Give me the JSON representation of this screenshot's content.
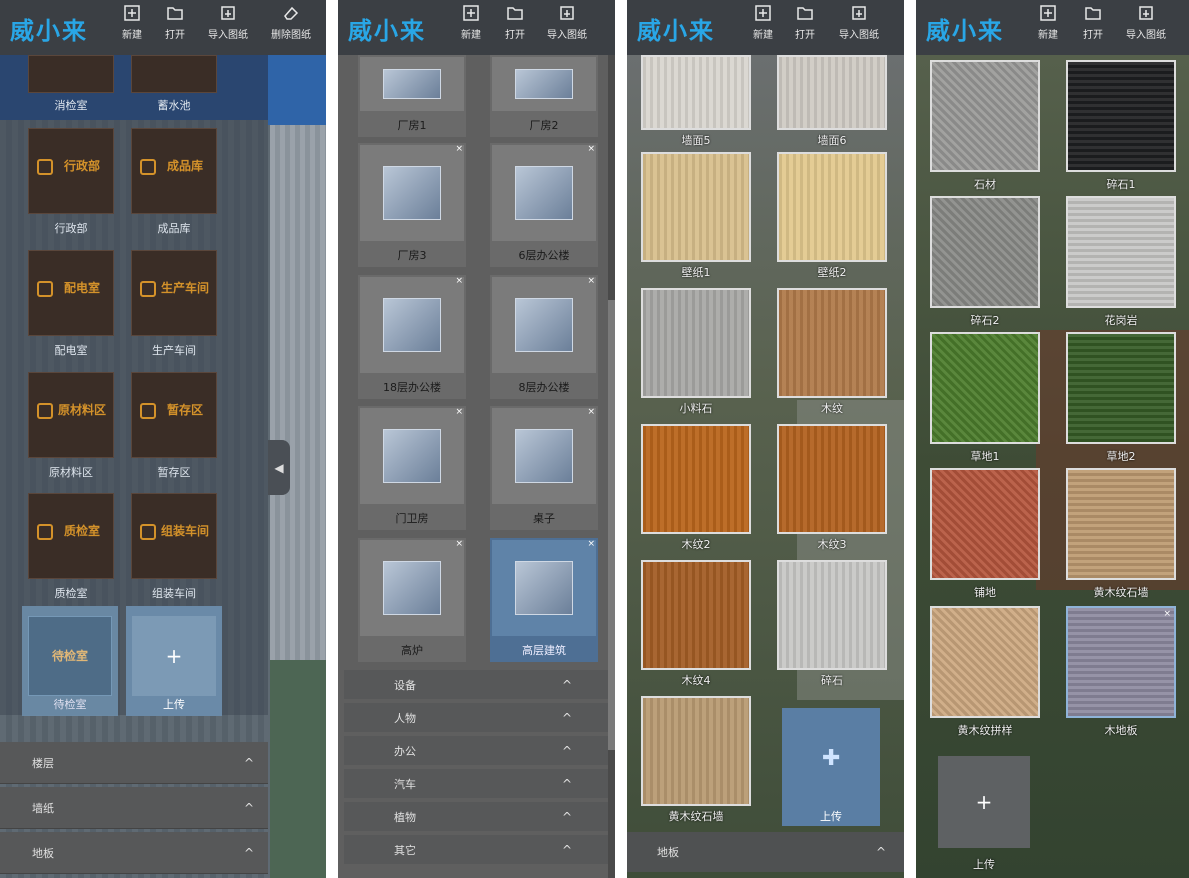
{
  "app": {
    "logo": "威小来"
  },
  "toolbar": {
    "new": "新建",
    "open": "打开",
    "import": "导入图纸",
    "delete": "删除图纸"
  },
  "panel1": {
    "top_labels": [
      "消检室",
      "蓄水池"
    ],
    "signs": [
      {
        "sign_text": "行政部",
        "label": "行政部"
      },
      {
        "sign_text": "成品库",
        "label": "成品库"
      },
      {
        "sign_text": "配电室",
        "label": "配电室"
      },
      {
        "sign_text": "生产车间",
        "label": "生产车间"
      },
      {
        "sign_text": "原材料区",
        "label": "原材料区"
      },
      {
        "sign_text": "暂存区",
        "label": "暂存区"
      },
      {
        "sign_text": "质检室",
        "label": "质检室"
      },
      {
        "sign_text": "组装车间",
        "label": "组装车间"
      }
    ],
    "selected": {
      "sign_text": "待检室",
      "label": "待检室"
    },
    "upload": {
      "symbol": "+",
      "label": "上传"
    },
    "sections": [
      "楼层",
      "墙纸",
      "地板"
    ]
  },
  "panel2": {
    "cards": [
      {
        "label": "厂房1"
      },
      {
        "label": "厂房2"
      },
      {
        "label": "厂房3"
      },
      {
        "label": "6层办公楼"
      },
      {
        "label": "18层办公楼"
      },
      {
        "label": "8层办公楼"
      },
      {
        "label": "门卫房"
      },
      {
        "label": "桌子"
      },
      {
        "label": "高炉"
      },
      {
        "label": "高层建筑"
      }
    ],
    "close": "×",
    "sections": [
      "设备",
      "人物",
      "办公",
      "汽车",
      "植物",
      "其它"
    ],
    "chevron": "^"
  },
  "panel3": {
    "textures": [
      {
        "label": "墙面5",
        "color": "#d9d6cf"
      },
      {
        "label": "墙面6",
        "color": "#cfcbc4"
      },
      {
        "label": "壁纸1",
        "color": "#d8bf8c"
      },
      {
        "label": "壁纸2",
        "color": "#e2c98e"
      },
      {
        "label": "小料石",
        "color": "#a8a8a6"
      },
      {
        "label": "木纹",
        "color": "#b07a4a"
      },
      {
        "label": "木纹2",
        "color": "#b9651c"
      },
      {
        "label": "木纹3",
        "color": "#b1611f"
      },
      {
        "label": "木纹4",
        "color": "#a35d25"
      },
      {
        "label": "碎石",
        "color": "#c8c8c6"
      },
      {
        "label": "黄木纹石墙",
        "color": "#b89a72"
      }
    ],
    "upload_label": "上传",
    "section": "地板"
  },
  "panel4": {
    "textures": [
      {
        "label": "石材",
        "color": "#9a9a98"
      },
      {
        "label": "碎石1",
        "color": "#1e1f21"
      },
      {
        "label": "碎石2",
        "color": "#8a8b88"
      },
      {
        "label": "花岗岩",
        "color": "#c7c7c5"
      },
      {
        "label": "草地1",
        "color": "#4c7d2c"
      },
      {
        "label": "草地2",
        "color": "#355b26"
      },
      {
        "label": "铺地",
        "color": "#b5563d"
      },
      {
        "label": "黄木纹石墙",
        "color": "#bd9a70"
      },
      {
        "label": "黄木纹拼样",
        "color": "#cda880"
      },
      {
        "label": "木地板",
        "color": "#8d8aa0"
      }
    ],
    "upload": {
      "symbol": "+",
      "label": "上传"
    }
  }
}
